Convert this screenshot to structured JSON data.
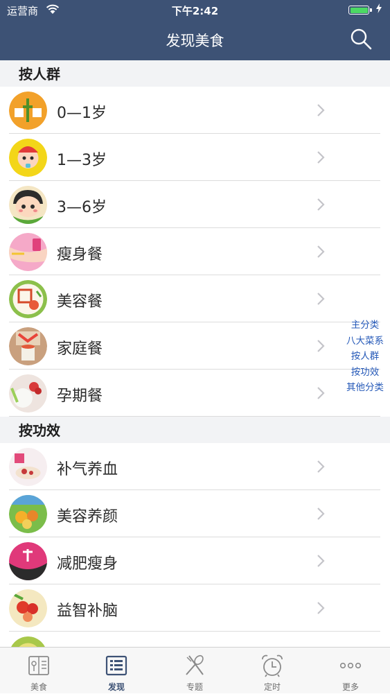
{
  "status": {
    "carrier": "运营商",
    "time": "下午2:42"
  },
  "nav": {
    "title": "发现美食"
  },
  "sections": [
    {
      "title": "按人群",
      "items": [
        {
          "label": "0—1岁"
        },
        {
          "label": "1—3岁"
        },
        {
          "label": "3—6岁"
        },
        {
          "label": "瘦身餐"
        },
        {
          "label": "美容餐"
        },
        {
          "label": "家庭餐"
        },
        {
          "label": "孕期餐"
        }
      ]
    },
    {
      "title": "按功效",
      "items": [
        {
          "label": "补气养血"
        },
        {
          "label": "美容养颜"
        },
        {
          "label": "减肥瘦身"
        },
        {
          "label": "益智补脑"
        }
      ]
    }
  ],
  "index": [
    "主分类",
    "八大菜系",
    "按人群",
    "按功效",
    "其他分类"
  ],
  "tabs": [
    {
      "label": "美食"
    },
    {
      "label": "发现"
    },
    {
      "label": "专题"
    },
    {
      "label": "定时"
    },
    {
      "label": "更多"
    }
  ],
  "colors": {
    "nav_bg": "#3d5275",
    "index_text": "#2559b8",
    "battery": "#4cd964"
  }
}
